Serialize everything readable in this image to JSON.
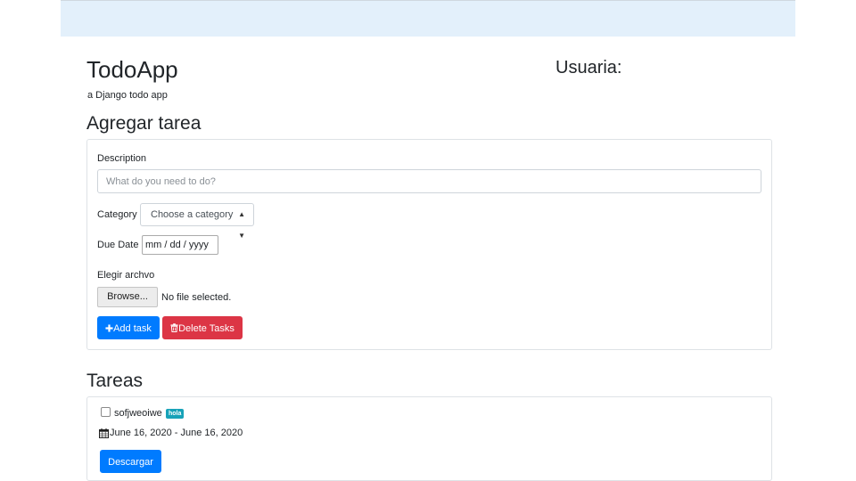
{
  "header": {
    "app_title": "TodoApp",
    "app_subtitle": "a Django todo app",
    "user_label": "Usuaria:"
  },
  "add_form": {
    "title": "Agregar tarea",
    "description_label": "Description",
    "description_placeholder": "What do you need to do?",
    "description_value": "",
    "category_label": "Category",
    "category_selected": "Choose a category",
    "due_date_label": "Due Date",
    "due_date_value": "mm / dd / yyyy",
    "file_label": "Elegir archvo",
    "browse_label": "Browse...",
    "file_status": "No file selected.",
    "add_button_label": "Add task",
    "delete_button_label": "Delete Tasks"
  },
  "tasks": {
    "title": "Tareas",
    "items": [
      {
        "name": "sofjweoiwe",
        "badge": "hola",
        "dates": "June 16, 2020 - June 16, 2020",
        "download_label": "Descargar",
        "checked": false
      }
    ]
  },
  "colors": {
    "primary": "#007bff",
    "danger": "#dc3545",
    "badge": "#17a2b8",
    "topbar": "#e3f0fb"
  },
  "icons": {
    "add": "plus-icon",
    "delete": "trash-icon",
    "date": "calendar-icon",
    "select": "updown-arrows-icon"
  }
}
